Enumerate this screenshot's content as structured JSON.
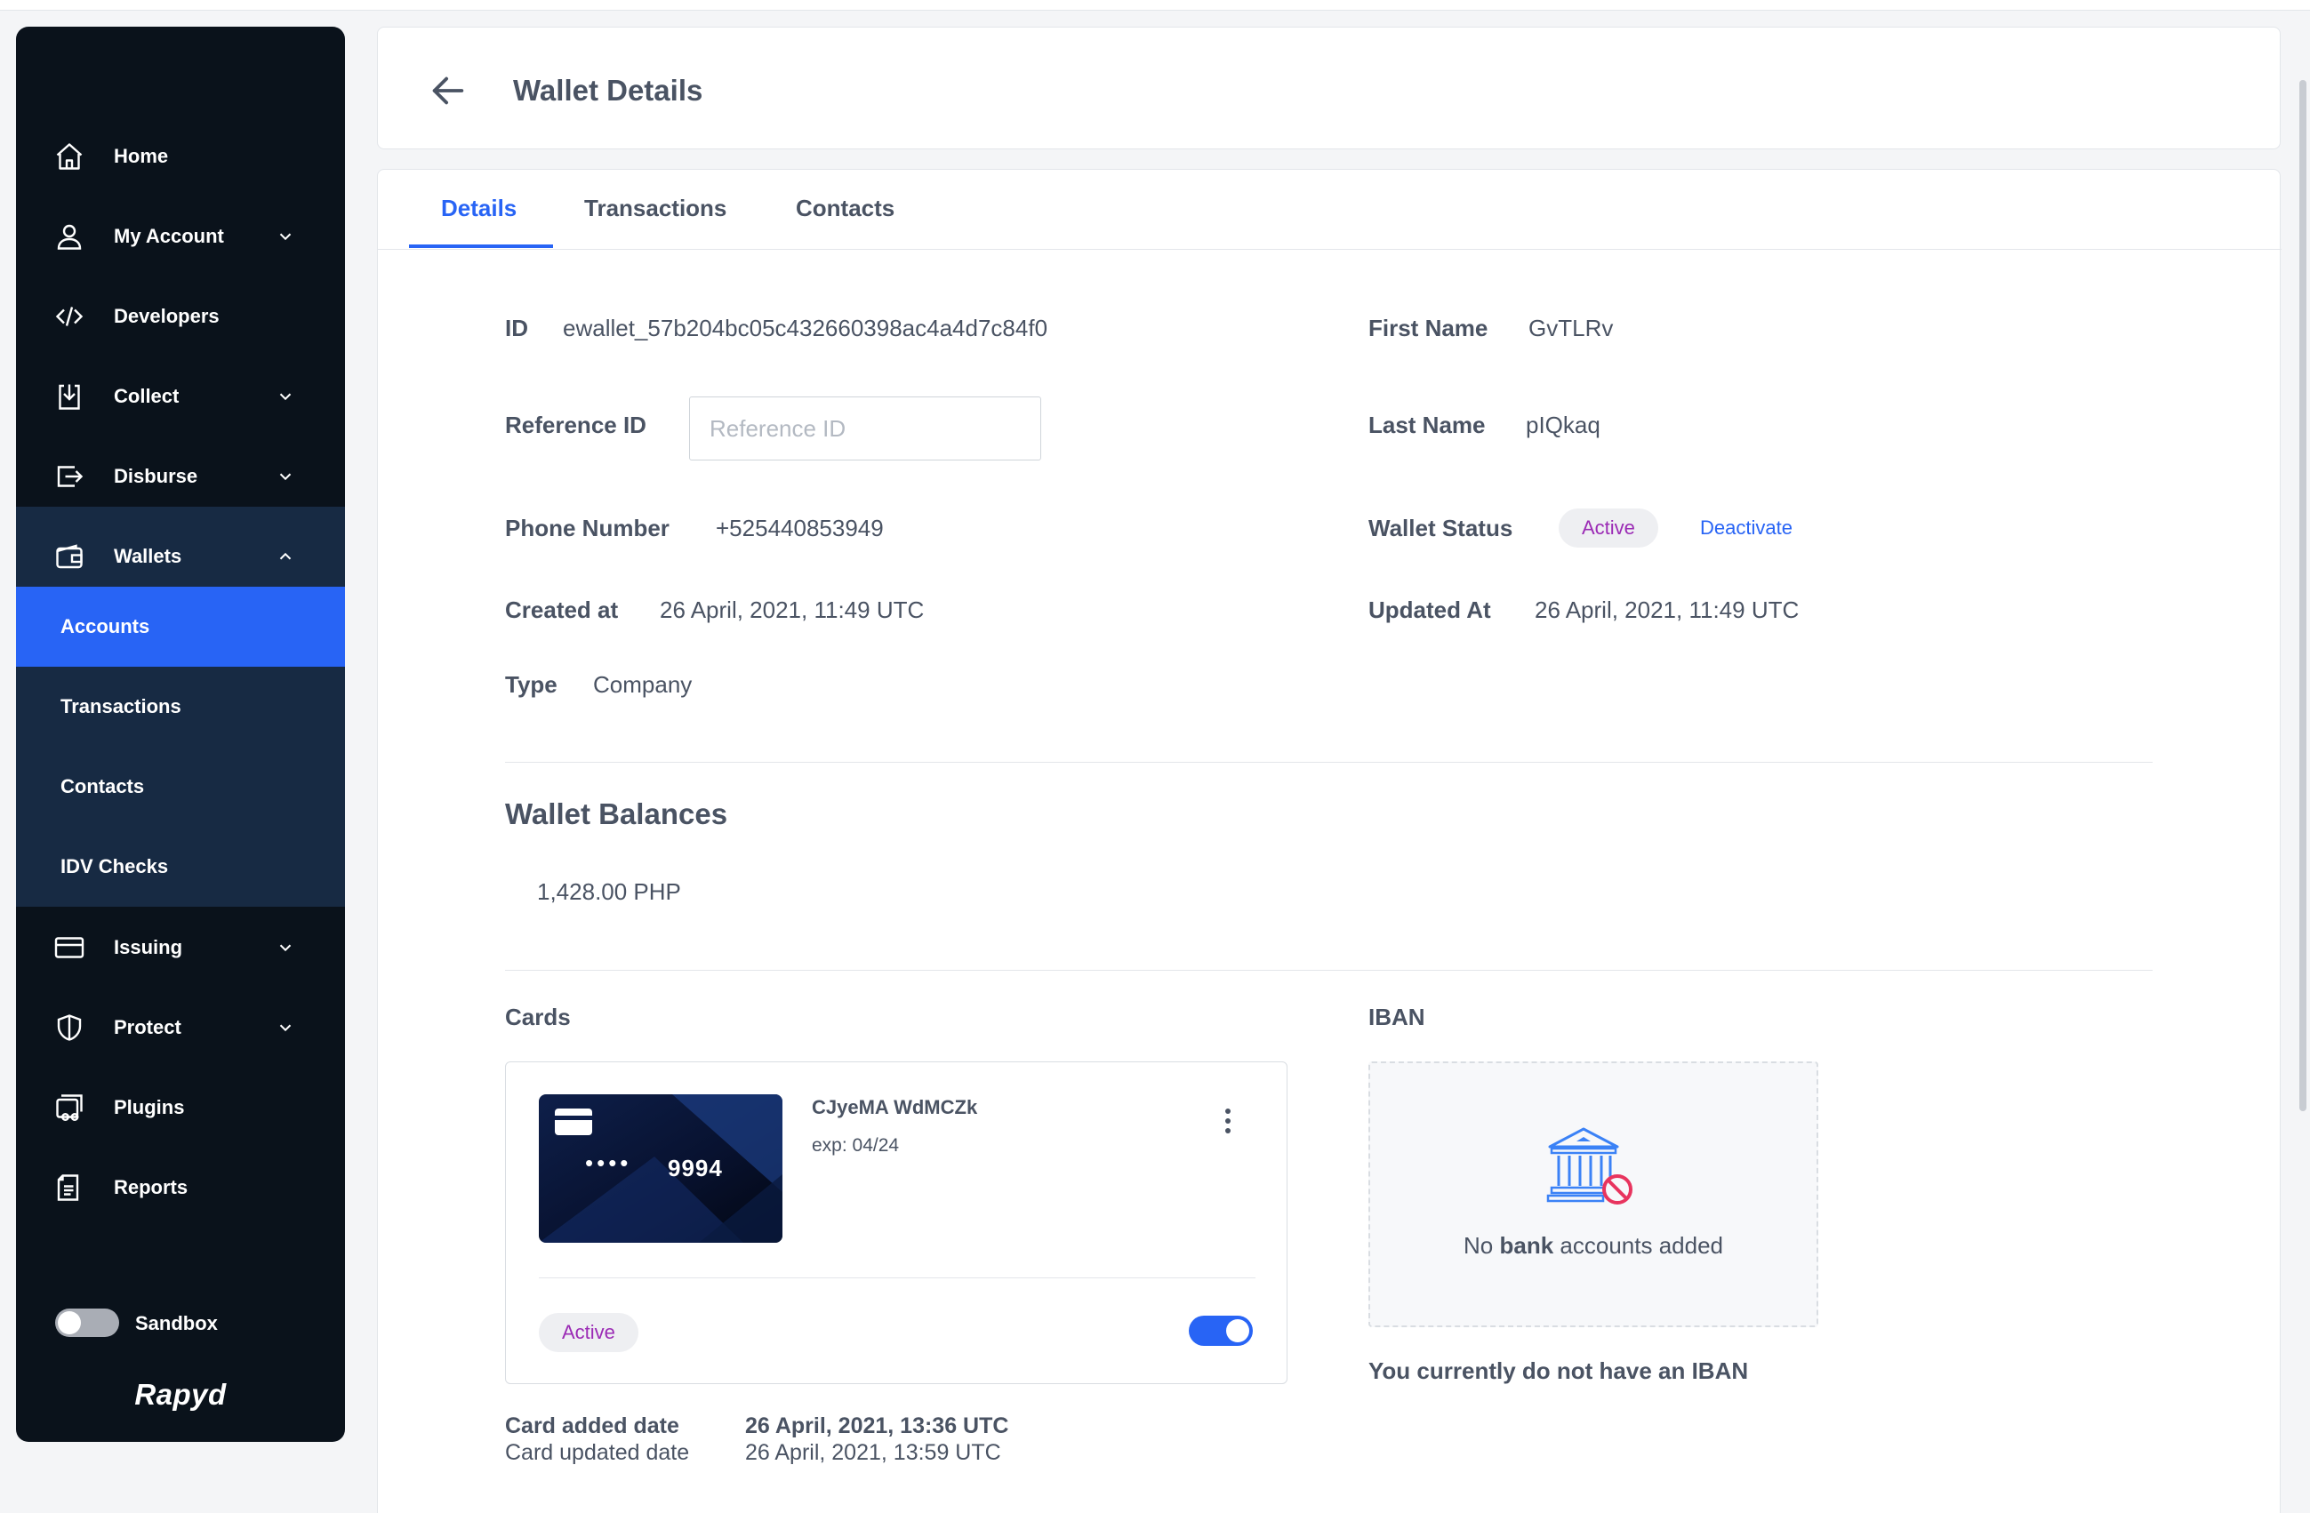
{
  "sidebar": {
    "items": [
      {
        "label": "Home",
        "icon": "home-icon"
      },
      {
        "label": "My Account",
        "icon": "user-icon"
      },
      {
        "label": "Developers",
        "icon": "code-icon"
      },
      {
        "label": "Collect",
        "icon": "collect-icon"
      },
      {
        "label": "Disburse",
        "icon": "disburse-icon"
      },
      {
        "label": "Wallets",
        "icon": "wallet-icon"
      },
      {
        "label": "Issuing",
        "icon": "card-icon"
      },
      {
        "label": "Protect",
        "icon": "shield-icon"
      },
      {
        "label": "Plugins",
        "icon": "plugin-icon"
      },
      {
        "label": "Reports",
        "icon": "reports-icon"
      }
    ],
    "wallet_subitems": [
      "Accounts",
      "Transactions",
      "Contacts",
      "IDV Checks"
    ],
    "active_subitem": "Accounts",
    "sandbox_label": "Sandbox",
    "sandbox_enabled": false,
    "brand": "Rapyd"
  },
  "header": {
    "title": "Wallet Details",
    "back_icon": "arrow-left-icon"
  },
  "tabs": [
    {
      "label": "Details",
      "active": true
    },
    {
      "label": "Transactions",
      "active": false
    },
    {
      "label": "Contacts",
      "active": false
    }
  ],
  "details": {
    "id_label": "ID",
    "id_value": "ewallet_57b204bc05c432660398ac4a4d7c84f0",
    "reference_label": "Reference ID",
    "reference_placeholder": "Reference ID",
    "reference_value": "",
    "phone_label": "Phone Number",
    "phone_value": "+525440853949",
    "created_label": "Created at",
    "created_value": "26 April, 2021, 11:49 UTC",
    "type_label": "Type",
    "type_value": "Company",
    "first_name_label": "First Name",
    "first_name_value": "GvTLRv",
    "last_name_label": "Last Name",
    "last_name_value": "pIQkaq",
    "status_label": "Wallet Status",
    "status_value": "Active",
    "deactivate_label": "Deactivate",
    "updated_label": "Updated At",
    "updated_value": "26 April, 2021, 11:49 UTC"
  },
  "balances": {
    "title": "Wallet Balances",
    "items": [
      "1,428.00 PHP"
    ]
  },
  "cards": {
    "title": "Cards",
    "card": {
      "masked_dots": "••••",
      "last4": "9994",
      "holder": "CJyeMA WdMCZk",
      "exp": "exp: 04/24",
      "status": "Active",
      "enabled": true
    },
    "added_label": "Card added date",
    "added_value": "26 April, 2021, 13:36 UTC",
    "updated_label": "Card updated date",
    "updated_value": "26 April, 2021, 13:59 UTC"
  },
  "iban": {
    "title": "IBAN",
    "empty_prefix": "No",
    "empty_bold": "bank",
    "empty_suffix": "accounts added",
    "note": "You currently do not have an IBAN"
  },
  "colors": {
    "accent": "#2864f5",
    "sidebar_bg": "#0a121b",
    "sidebar_sub_bg": "#172a43",
    "status_text": "#9b2bb5",
    "no_icon": "#e8345e"
  }
}
